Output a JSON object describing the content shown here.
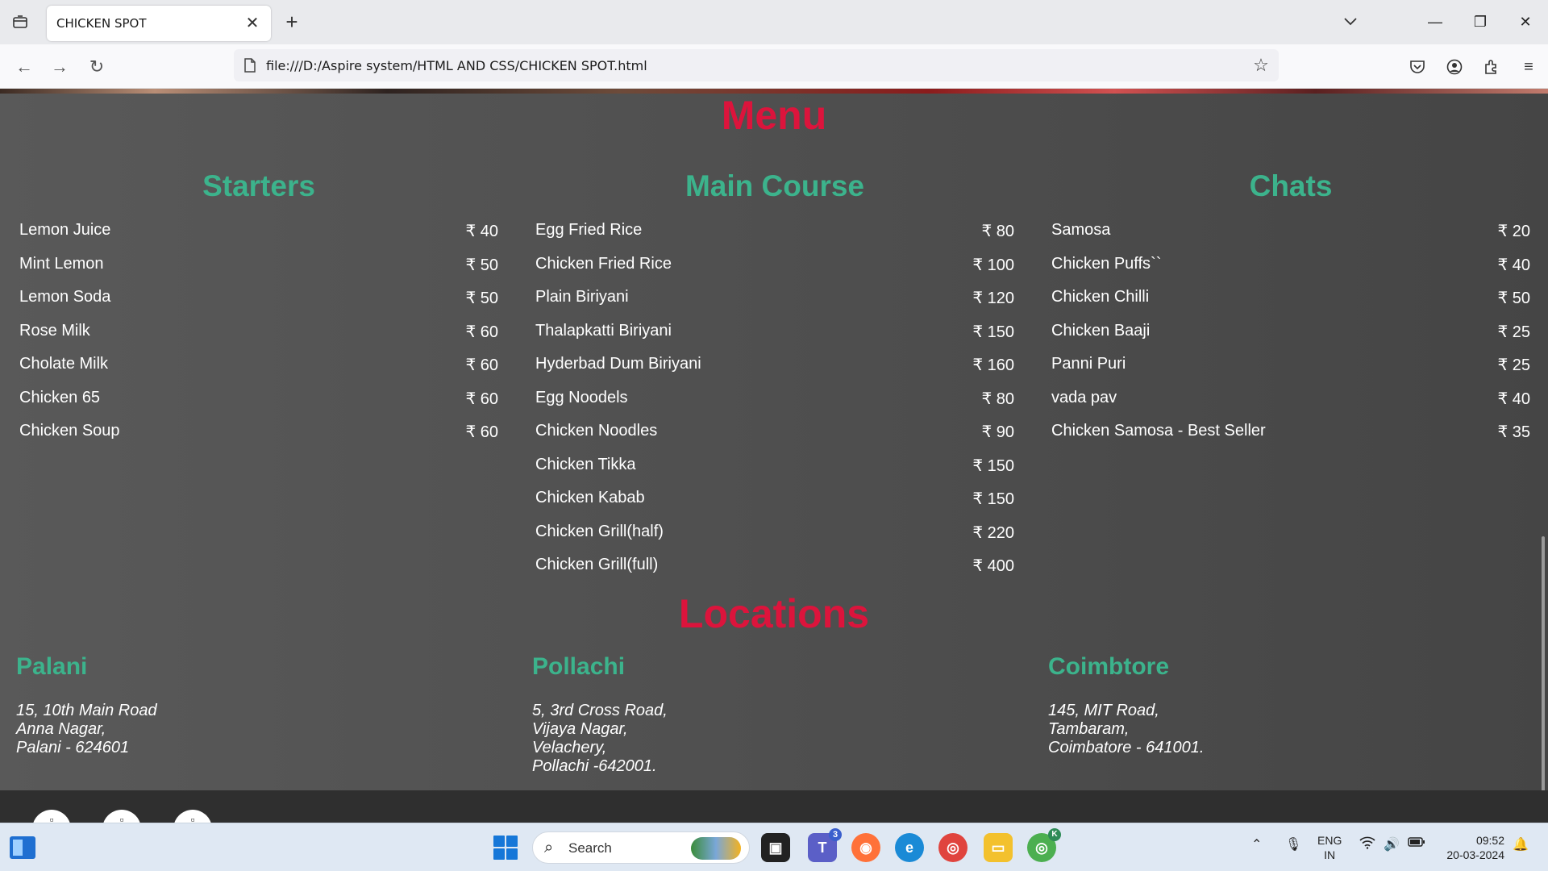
{
  "browser": {
    "tab_title": "CHICKEN SPOT",
    "url": "file:///D:/Aspire system/HTML AND CSS/CHICKEN SPOT.html"
  },
  "menu": {
    "title": "Menu",
    "columns": [
      {
        "heading": "Starters",
        "items": [
          {
            "name": "Lemon Juice",
            "price": "₹ 40"
          },
          {
            "name": "Mint Lemon",
            "price": "₹ 50"
          },
          {
            "name": "Lemon Soda",
            "price": "₹ 50"
          },
          {
            "name": "Rose Milk",
            "price": "₹ 60"
          },
          {
            "name": "Cholate Milk",
            "price": "₹ 60"
          },
          {
            "name": "Chicken 65",
            "price": "₹ 60"
          },
          {
            "name": "Chicken Soup",
            "price": "₹ 60"
          }
        ]
      },
      {
        "heading": "Main Course",
        "items": [
          {
            "name": "Egg Fried Rice",
            "price": "₹ 80"
          },
          {
            "name": "Chicken Fried Rice",
            "price": "₹ 100"
          },
          {
            "name": "Plain Biriyani",
            "price": "₹ 120"
          },
          {
            "name": "Thalapkatti Biriyani",
            "price": "₹ 150"
          },
          {
            "name": "Hyderbad Dum Biriyani",
            "price": "₹ 160"
          },
          {
            "name": "Egg Noodels",
            "price": "₹ 80"
          },
          {
            "name": "Chicken Noodles",
            "price": "₹ 90"
          },
          {
            "name": "Chicken Tikka",
            "price": "₹ 150"
          },
          {
            "name": "Chicken Kabab",
            "price": "₹ 150"
          },
          {
            "name": "Chicken Grill(half)",
            "price": "₹ 220"
          },
          {
            "name": "Chicken Grill(full)",
            "price": "₹ 400"
          }
        ]
      },
      {
        "heading": "Chats",
        "items": [
          {
            "name": "Samosa",
            "price": "₹ 20"
          },
          {
            "name": "Chicken Puffs``",
            "price": "₹ 40"
          },
          {
            "name": "Chicken Chilli",
            "price": "₹ 50"
          },
          {
            "name": "Chicken Baaji",
            "price": "₹ 25"
          },
          {
            "name": "Panni Puri",
            "price": "₹ 25"
          },
          {
            "name": "vada pav",
            "price": "₹ 40"
          },
          {
            "name": "Chicken Samosa - Best Seller",
            "price": "₹ 35"
          }
        ]
      }
    ]
  },
  "locations": {
    "title": "Locations",
    "items": [
      {
        "city": "Palani",
        "lines": [
          "15, 10th Main Road",
          "Anna Nagar,",
          "Palani - 624601",
          ""
        ]
      },
      {
        "city": "Pollachi",
        "lines": [
          "5, 3rd Cross Road,",
          "Vijaya Nagar,",
          "Velachery,",
          "Pollachi -642001."
        ]
      },
      {
        "city": "Coimbtore",
        "lines": [
          "145, MIT Road,",
          "Tambaram,",
          "Coimbatore - 641001.",
          ""
        ]
      }
    ]
  },
  "taskbar": {
    "search_label": "Search",
    "teams_badge": "3",
    "chrome_badge": "K",
    "lang_line1": "ENG",
    "lang_line2": "IN",
    "time": "09:52",
    "date": "20-03-2024"
  },
  "colors": {
    "accent_red": "#dc143c",
    "accent_green": "#3cb38c"
  }
}
